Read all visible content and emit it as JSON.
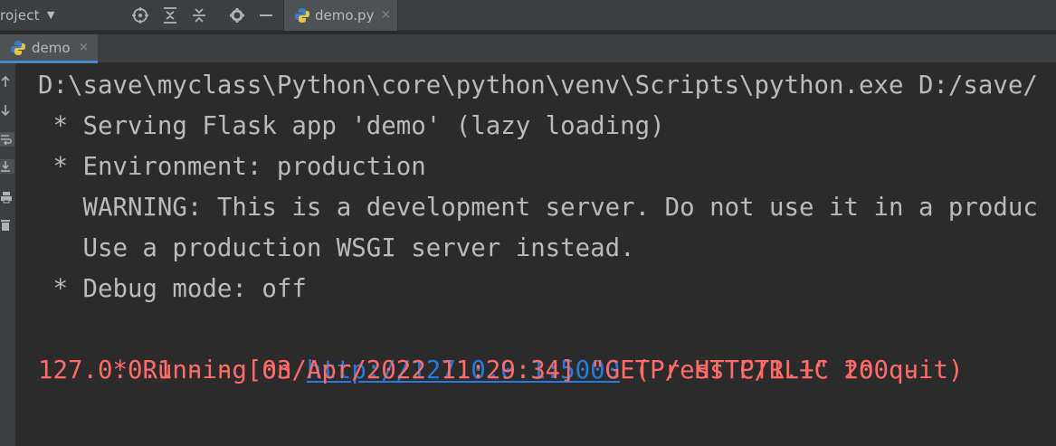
{
  "toolbar": {
    "project_label": "roject",
    "icons": [
      "dropdown-chevron",
      "locate-icon",
      "expand-all-icon",
      "collapse-all-icon",
      "settings-icon",
      "minimize-icon"
    ]
  },
  "editor_tab": {
    "label": "demo.py",
    "close": "×"
  },
  "run_tab": {
    "label": "demo",
    "close": "×"
  },
  "console": {
    "line1": "D:\\save\\myclass\\Python\\core\\python\\venv\\Scripts\\python.exe D:/save/",
    "line2": " * Serving Flask app 'demo' (lazy loading)",
    "line3": " * Environment: production",
    "line4": "   WARNING: This is a development server. Do not use it in a produc",
    "line5": "   Use a production WSGI server instead.",
    "line6": " * Debug mode: off",
    "line7_prefix": " * Running on ",
    "line7_link": "http://127.0.0.1:5000",
    "line7_suffix": " (Press CTRL+C to quit)",
    "line8": "127.0.0.1 - - [03/Apr/2022 11:29:34] \"GET / HTTP/1.1\" 200 -"
  },
  "colors": {
    "background": "#2b2b2b",
    "normal_text": "#bbbbbb",
    "error_text": "#ff6b68",
    "link": "#287bde",
    "accent": "#4a88c7"
  }
}
